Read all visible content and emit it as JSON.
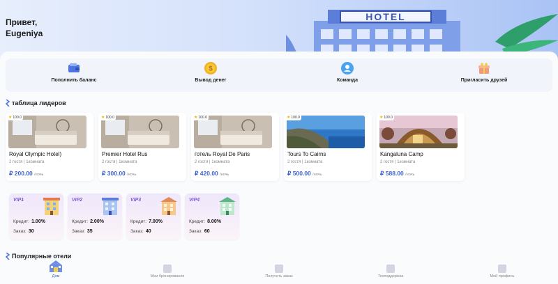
{
  "greeting": {
    "line1": "Привет,",
    "line2": "Eugeniya"
  },
  "hero": {
    "sign": "HOTEL"
  },
  "actions": [
    {
      "label": "Пополнить баланс",
      "icon": "wallet-icon"
    },
    {
      "label": "Вывод денег",
      "icon": "coin-icon"
    },
    {
      "label": "Команда",
      "icon": "team-icon"
    },
    {
      "label": "Пригласить друзей",
      "icon": "gift-icon"
    }
  ],
  "leaderboard": {
    "title": "таблица лидеров",
    "cards": [
      {
        "rating": "100.0",
        "name": "Royal Olympic Hotel)",
        "meta": "2 гостя | 1комната",
        "price": "₽ 200.00",
        "per": "/ночь"
      },
      {
        "rating": "100.0",
        "name": "Premier Hotel Rus",
        "meta": "2 гостя | 1комната",
        "price": "₽ 300.00",
        "per": "/ночь"
      },
      {
        "rating": "100.0",
        "name": "готель Royal De Paris",
        "meta": "2 гостя | 1комната",
        "price": "₽ 420.00",
        "per": "/ночь"
      },
      {
        "rating": "100.0",
        "name": "Tours To Cairns",
        "meta": "2 гостя | 1комната",
        "price": "₽ 500.00",
        "per": "/ночь"
      },
      {
        "rating": "100.0",
        "name": "Kangaluna Camp",
        "meta": "2 гостя | 1комната",
        "price": "₽ 588.00",
        "per": "/ночь"
      }
    ]
  },
  "vip": {
    "credit_label": "Кредит:",
    "order_label": "Заказ:",
    "levels": [
      {
        "tag": "VIP1",
        "credit": "1.00%",
        "orders": "30"
      },
      {
        "tag": "VIP2",
        "credit": "2.00%",
        "orders": "35"
      },
      {
        "tag": "VIP3",
        "credit": "7.00%",
        "orders": "40"
      },
      {
        "tag": "VIP4",
        "credit": "8.00%",
        "orders": "60"
      }
    ]
  },
  "popular": {
    "title": "Популярные отели"
  },
  "nav": [
    {
      "label": "Дом",
      "icon": "home-icon"
    },
    {
      "label": "Мои бронирования",
      "icon": "bookings-icon"
    },
    {
      "label": "Получить заказ",
      "icon": "grid-icon"
    },
    {
      "label": "Техподдержка",
      "icon": "support-icon"
    },
    {
      "label": "Мой профиль",
      "icon": "profile-icon"
    }
  ],
  "colors": {
    "accent": "#3f63c9",
    "vip_text": "#7a5ad0",
    "star": "#f5b400"
  }
}
